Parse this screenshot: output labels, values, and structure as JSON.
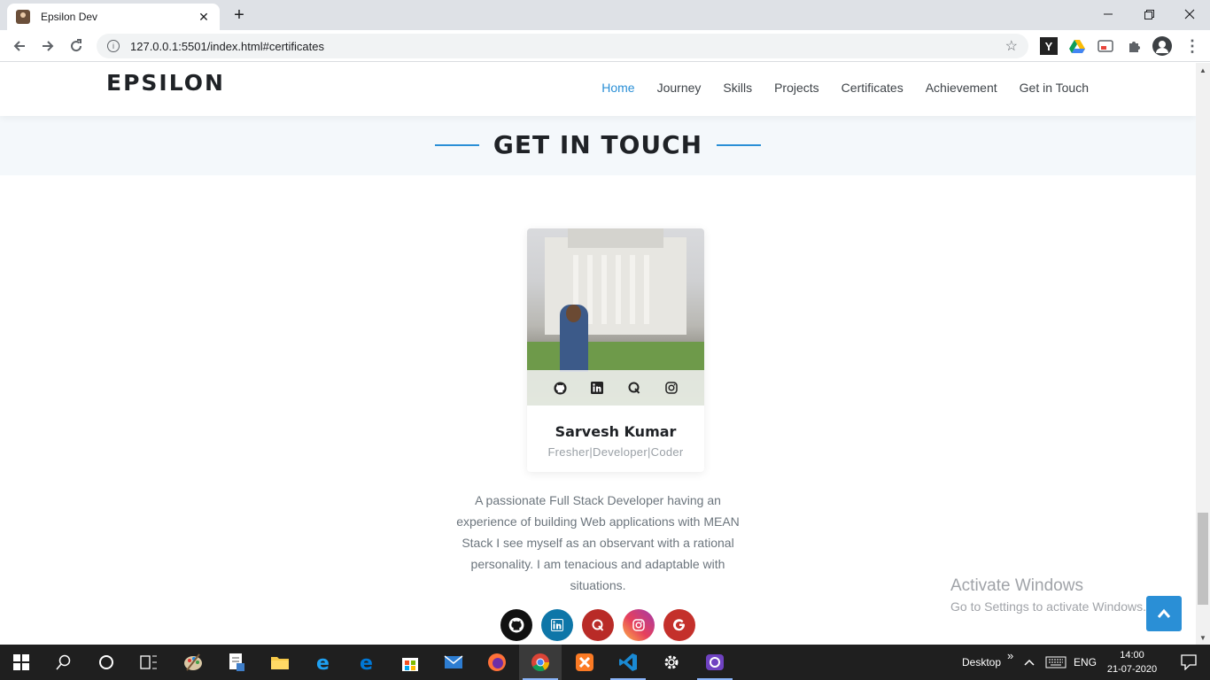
{
  "browser": {
    "tab_title": "Epsilon Dev",
    "tab_close": "✕",
    "new_tab": "+",
    "url": "127.0.0.1:5501/index.html#certificates"
  },
  "site": {
    "logo": "EPSILON",
    "nav": [
      "Home",
      "Journey",
      "Skills",
      "Projects",
      "Certificates",
      "Achievement",
      "Get in Touch"
    ],
    "active_nav": "Home",
    "section_title": "GET IN TOUCH"
  },
  "profile": {
    "name": "Sarvesh Kumar",
    "role": "Fresher|Developer|Coder",
    "card_socials": [
      "github-icon",
      "linkedin-icon",
      "quora-icon",
      "instagram-icon"
    ],
    "bio": "A passionate Full Stack Developer having an experience of building Web applications with MEAN Stack I see myself as an observant with a rational personality. I am tenacious and adaptable with situations."
  },
  "social_buttons": [
    {
      "icon": "github-icon",
      "color": "#111111"
    },
    {
      "icon": "linkedin-icon",
      "color": "#0e76a8"
    },
    {
      "icon": "quora-icon",
      "color": "#b92b27"
    },
    {
      "icon": "instagram-icon",
      "color": "#d6249f"
    },
    {
      "icon": "google-icon",
      "color": "#c4302b"
    }
  ],
  "watermark": {
    "title": "Activate Windows",
    "subtitle": "Go to Settings to activate Windows."
  },
  "taskbar": {
    "desktop_label": "Desktop",
    "chevron": "»",
    "language": "ENG",
    "time": "14:00",
    "date": "21-07-2020"
  },
  "colors": {
    "accent": "#2a8fd6",
    "heading": "#1f2226",
    "muted": "#6c757d"
  }
}
